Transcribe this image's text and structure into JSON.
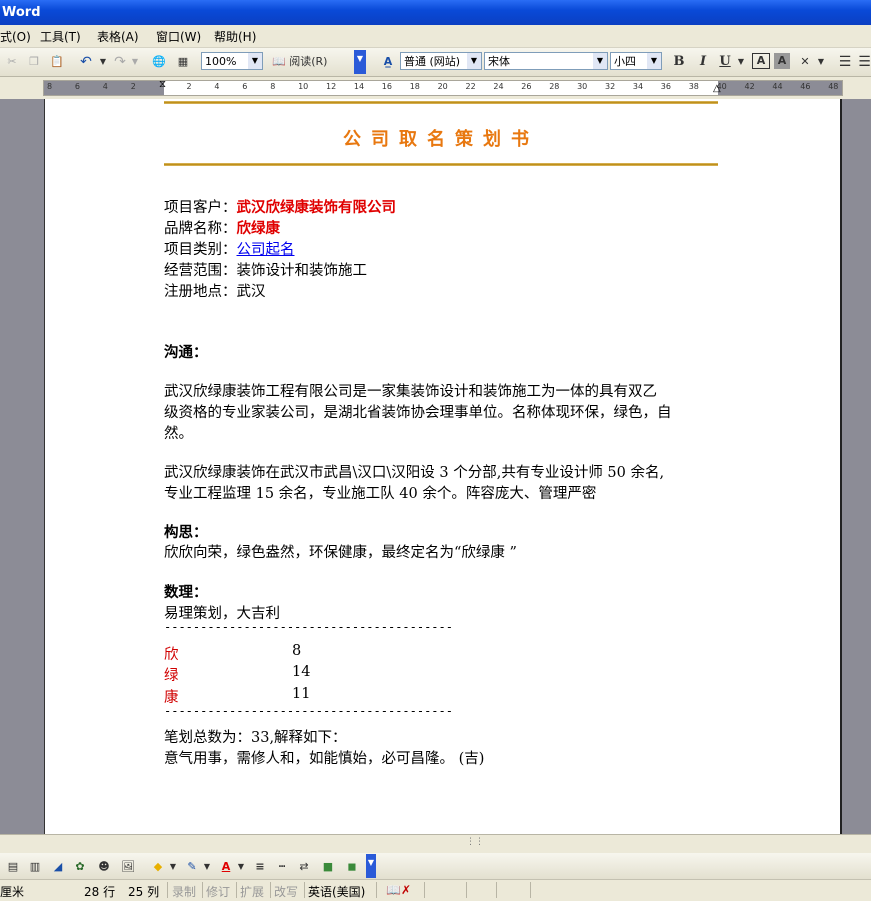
{
  "window": {
    "title": "Word"
  },
  "menu": [
    {
      "label": "式(O)"
    },
    {
      "label": "工具(T)"
    },
    {
      "label": "表格(A)"
    },
    {
      "label": "窗口(W)"
    },
    {
      "label": "帮助(H)"
    }
  ],
  "toolbar": {
    "zoom": "100%",
    "read_label": "阅读(R)",
    "style": "普通 (网站)",
    "font": "宋体",
    "size": "小四",
    "bold": "B",
    "italic": "I",
    "underline": "U"
  },
  "ruler": {
    "ticks": [
      "8",
      "6",
      "4",
      "2",
      "",
      "2",
      "4",
      "6",
      "8",
      "10",
      "12",
      "14",
      "16",
      "18",
      "20",
      "22",
      "24",
      "26",
      "28",
      "30",
      "32",
      "34",
      "36",
      "38",
      "40",
      "42",
      "44",
      "46",
      "48"
    ]
  },
  "document": {
    "title": "公司取名策划书",
    "fields": [
      {
        "label": "项目客户：",
        "value": "武汉欣绿康装饰有限公司"
      },
      {
        "label": "品牌名称：",
        "value": "欣绿康"
      },
      {
        "label": "项目类别：",
        "value": "公司起名"
      },
      {
        "label": "经营范围：",
        "value": "装饰设计和装饰施工"
      },
      {
        "label": "注册地点：",
        "value": "武汉"
      }
    ],
    "section_comm": "沟通：",
    "para1": [
      "武汉欣绿康装饰工程有限公司是一家集装饰设计和装饰施工为一体的具有双乙",
      "级资格的专业家装公司，是湖北省装饰协会理事单位。名称体现环保，绿色，自",
      "然。"
    ],
    "para2": [
      "武汉欣绿康装饰在武汉市武昌\\汉口\\汉阳设 3 个分部,共有专业设计师 50 余名,",
      "专业工程监理 15 余名，专业施工队 40 余个。阵容庞大、管理严密"
    ],
    "section_idea": "构思：",
    "idea_text": "欣欣向荣，绿色盎然，环保健康，最终定名为“欣绿康 ”",
    "section_num": "数理：",
    "num_text": "易理策划，大吉利",
    "divider": "----------------------------------------",
    "strokes": [
      {
        "char": "欣",
        "count": "8"
      },
      {
        "char": "绿",
        "count": "14"
      },
      {
        "char": "康",
        "count": "11"
      }
    ],
    "total": "笔划总数为：33,解释如下：",
    "interpretation": "意气用事，需修人和，如能慎始，必可昌隆。 (吉)"
  },
  "status": {
    "unit": "厘米",
    "line": "28 行",
    "col": "25 列",
    "rec": "录制",
    "trk": "修订",
    "ext": "扩展",
    "ovr": "改写",
    "lang": "英语(美国)"
  }
}
